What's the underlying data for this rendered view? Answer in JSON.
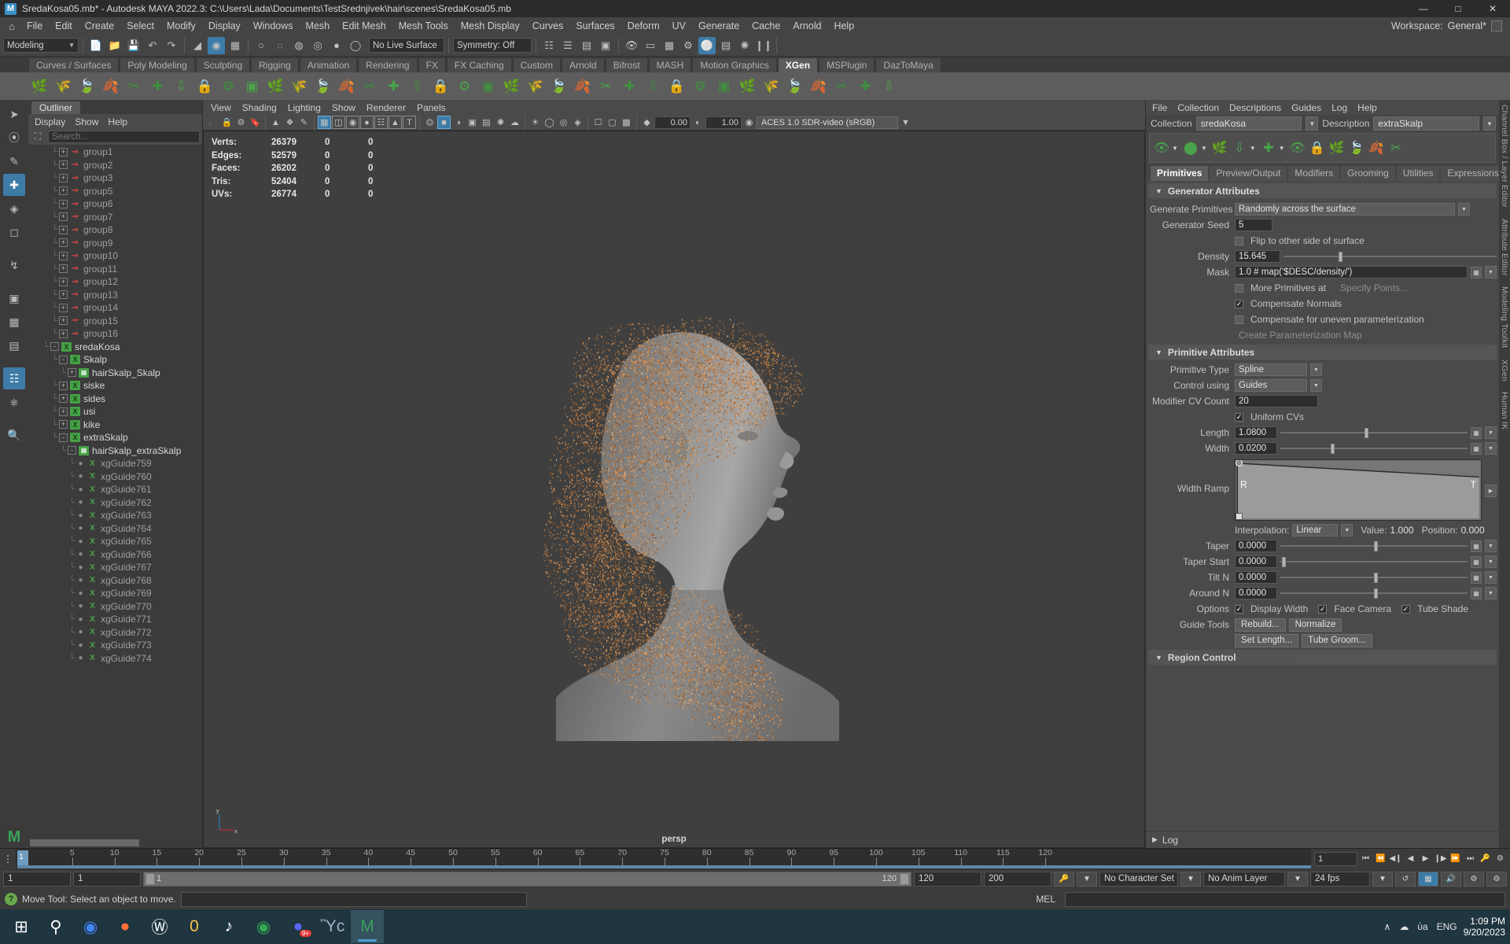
{
  "titlebar": {
    "title": "SredaKosa05.mb* - Autodesk MAYA 2022.3: C:\\Users\\Lada\\Documents\\TestSrednjivek\\hair\\scenes\\SredaKosa05.mb",
    "logo": "M",
    "minimize": "—",
    "maximize": "□",
    "close": "✕"
  },
  "menubar": {
    "home_icon": "home-icon",
    "items": [
      "File",
      "Edit",
      "Create",
      "Select",
      "Modify",
      "Display",
      "Windows",
      "Mesh",
      "Edit Mesh",
      "Mesh Tools",
      "Mesh Display",
      "Curves",
      "Surfaces",
      "Deform",
      "UV",
      "Generate",
      "Cache",
      "Arnold",
      "Help"
    ],
    "workspace_label": "Workspace:",
    "workspace_value": "General*"
  },
  "toolrow": {
    "mode_value": "Modeling",
    "live_surface": "No Live Surface",
    "symmetry": "Symmetry: Off"
  },
  "shelf": {
    "tabs": [
      "Curves / Surfaces",
      "Poly Modeling",
      "Sculpting",
      "Rigging",
      "Animation",
      "Rendering",
      "FX",
      "FX Caching",
      "Custom",
      "Arnold",
      "Bifrost",
      "MASH",
      "Motion Graphics",
      "XGen",
      "MSPlugin",
      "DazToMaya"
    ],
    "active_tab": "XGen"
  },
  "outliner": {
    "tab_label": "Outliner",
    "menus": [
      "Display",
      "Show",
      "Help"
    ],
    "search_placeholder": "Search...",
    "search_value": "",
    "tree": [
      {
        "label": "group1",
        "indent": 2,
        "icon": "group-icon",
        "expander": "+",
        "bright": false
      },
      {
        "label": "group2",
        "indent": 2,
        "icon": "group-icon",
        "expander": "+",
        "bright": false
      },
      {
        "label": "group3",
        "indent": 2,
        "icon": "group-icon",
        "expander": "+",
        "bright": false
      },
      {
        "label": "group5",
        "indent": 2,
        "icon": "group-icon",
        "expander": "+",
        "bright": false
      },
      {
        "label": "group6",
        "indent": 2,
        "icon": "group-icon",
        "expander": "+",
        "bright": false
      },
      {
        "label": "group7",
        "indent": 2,
        "icon": "group-icon",
        "expander": "+",
        "bright": false
      },
      {
        "label": "group8",
        "indent": 2,
        "icon": "group-icon",
        "expander": "+",
        "bright": false
      },
      {
        "label": "group9",
        "indent": 2,
        "icon": "group-icon",
        "expander": "+",
        "bright": false
      },
      {
        "label": "group10",
        "indent": 2,
        "icon": "group-icon",
        "expander": "+",
        "bright": false
      },
      {
        "label": "group11",
        "indent": 2,
        "icon": "group-icon",
        "expander": "+",
        "bright": false
      },
      {
        "label": "group12",
        "indent": 2,
        "icon": "group-icon",
        "expander": "+",
        "bright": false
      },
      {
        "label": "group13",
        "indent": 2,
        "icon": "group-icon",
        "expander": "+",
        "bright": false
      },
      {
        "label": "group14",
        "indent": 2,
        "icon": "group-icon",
        "expander": "+",
        "bright": false
      },
      {
        "label": "group15",
        "indent": 2,
        "icon": "group-icon",
        "expander": "+",
        "bright": false
      },
      {
        "label": "group16",
        "indent": 2,
        "icon": "group-icon",
        "expander": "+",
        "bright": false
      },
      {
        "label": "sredaKosa",
        "indent": 1,
        "icon": "xgen-icon",
        "expander": "-",
        "bright": true
      },
      {
        "label": "Skalp",
        "indent": 2,
        "icon": "xgen-desc-icon",
        "expander": "-",
        "bright": true
      },
      {
        "label": "hairSkalp_Skalp",
        "indent": 3,
        "icon": "mesh-icon",
        "expander": "+",
        "bright": true
      },
      {
        "label": "siske",
        "indent": 2,
        "icon": "xgen-desc-icon",
        "expander": "+",
        "bright": true
      },
      {
        "label": "sides",
        "indent": 2,
        "icon": "xgen-desc-icon",
        "expander": "+",
        "bright": true
      },
      {
        "label": "usi",
        "indent": 2,
        "icon": "xgen-desc-icon",
        "expander": "+",
        "bright": true
      },
      {
        "label": "kike",
        "indent": 2,
        "icon": "xgen-desc-icon",
        "expander": "+",
        "bright": true
      },
      {
        "label": "extraSkalp",
        "indent": 2,
        "icon": "xgen-desc-icon",
        "expander": "-",
        "bright": true
      },
      {
        "label": "hairSkalp_extraSkalp",
        "indent": 3,
        "icon": "mesh-icon",
        "expander": "-",
        "bright": true
      },
      {
        "label": "xgGuide759",
        "indent": 4,
        "icon": "guide-icon",
        "expander": ".",
        "bright": false
      },
      {
        "label": "xgGuide760",
        "indent": 4,
        "icon": "guide-icon",
        "expander": ".",
        "bright": false
      },
      {
        "label": "xgGuide761",
        "indent": 4,
        "icon": "guide-icon",
        "expander": ".",
        "bright": false
      },
      {
        "label": "xgGuide762",
        "indent": 4,
        "icon": "guide-icon",
        "expander": ".",
        "bright": false
      },
      {
        "label": "xgGuide763",
        "indent": 4,
        "icon": "guide-icon",
        "expander": ".",
        "bright": false
      },
      {
        "label": "xgGuide764",
        "indent": 4,
        "icon": "guide-icon",
        "expander": ".",
        "bright": false
      },
      {
        "label": "xgGuide765",
        "indent": 4,
        "icon": "guide-icon",
        "expander": ".",
        "bright": false
      },
      {
        "label": "xgGuide766",
        "indent": 4,
        "icon": "guide-icon",
        "expander": ".",
        "bright": false
      },
      {
        "label": "xgGuide767",
        "indent": 4,
        "icon": "guide-icon",
        "expander": ".",
        "bright": false
      },
      {
        "label": "xgGuide768",
        "indent": 4,
        "icon": "guide-icon",
        "expander": ".",
        "bright": false
      },
      {
        "label": "xgGuide769",
        "indent": 4,
        "icon": "guide-icon",
        "expander": ".",
        "bright": false
      },
      {
        "label": "xgGuide770",
        "indent": 4,
        "icon": "guide-icon",
        "expander": ".",
        "bright": false
      },
      {
        "label": "xgGuide771",
        "indent": 4,
        "icon": "guide-icon",
        "expander": ".",
        "bright": false
      },
      {
        "label": "xgGuide772",
        "indent": 4,
        "icon": "guide-icon",
        "expander": ".",
        "bright": false
      },
      {
        "label": "xgGuide773",
        "indent": 4,
        "icon": "guide-icon",
        "expander": ".",
        "bright": false
      },
      {
        "label": "xgGuide774",
        "indent": 4,
        "icon": "guide-icon",
        "expander": ".",
        "bright": false
      }
    ]
  },
  "viewport": {
    "menus": [
      "View",
      "Shading",
      "Lighting",
      "Show",
      "Renderer",
      "Panels"
    ],
    "exposure": "0.00",
    "gamma": "1.00",
    "color_space": "ACES 1.0 SDR-video (sRGB)",
    "camera_label": "persp",
    "heads_up": {
      "rows": [
        {
          "label": "Verts:",
          "total": "26379",
          "sel": "0",
          "extra": "0"
        },
        {
          "label": "Edges:",
          "total": "52579",
          "sel": "0",
          "extra": "0"
        },
        {
          "label": "Faces:",
          "total": "26202",
          "sel": "0",
          "extra": "0"
        },
        {
          "label": "Tris:",
          "total": "52404",
          "sel": "0",
          "extra": "0"
        },
        {
          "label": "UVs:",
          "total": "26774",
          "sel": "0",
          "extra": "0"
        }
      ]
    }
  },
  "xgen": {
    "menus": [
      "File",
      "Collection",
      "Descriptions",
      "Guides",
      "Log",
      "Help"
    ],
    "collection_label": "Collection",
    "collection_value": "sredaKosa",
    "description_label": "Description",
    "description_value": "extraSkalp",
    "tabs": [
      "Primitives",
      "Preview/Output",
      "Modifiers",
      "Grooming",
      "Utilities",
      "Expressions"
    ],
    "active_tab": "Primitives",
    "generator": {
      "section_title": "Generator Attributes",
      "generate_primitives_label": "Generate Primitives",
      "generate_primitives_value": "Randomly across the surface",
      "generator_seed_label": "Generator Seed",
      "generator_seed_value": "5",
      "flip_label": "Flip to other side of surface",
      "flip_checked": false,
      "density_label": "Density",
      "density_value": "15.645",
      "mask_label": "Mask",
      "mask_value": "1.0 # map('$DESC/density/')",
      "more_primitives_label": "More Primitives at",
      "more_primitives_checked": false,
      "specify_points_label": "Specify Points...",
      "compensate_normals_label": "Compensate Normals",
      "compensate_normals_checked": true,
      "compensate_uneven_label": "Compensate for uneven parameterization",
      "compensate_uneven_checked": false,
      "create_param_map_label": "Create Parameterization Map"
    },
    "primitive": {
      "section_title": "Primitive Attributes",
      "primitive_type_label": "Primitive Type",
      "primitive_type_value": "Spline",
      "control_using_label": "Control using",
      "control_using_value": "Guides",
      "modifier_cv_label": "Modifier CV Count",
      "modifier_cv_value": "20",
      "uniform_cvs_label": "Uniform CVs",
      "uniform_cvs_checked": true,
      "length_label": "Length",
      "length_value": "1.0800",
      "length_slider_pct": 45,
      "width_label": "Width",
      "width_value": "0.0200",
      "width_slider_pct": 27,
      "width_ramp_label": "Width Ramp",
      "interpolation_label": "Interpolation:",
      "interpolation_value": "Linear",
      "ramp_value_label": "Value:",
      "ramp_value": "1.000",
      "ramp_position_label": "Position:",
      "ramp_position": "0.000",
      "ramp_left_letter": "R",
      "ramp_right_letter": "T",
      "taper_label": "Taper",
      "taper_value": "0.0000",
      "taper_slider_pct": 50,
      "taper_start_label": "Taper Start",
      "taper_start_value": "0.0000",
      "taper_start_slider_pct": 2,
      "tilt_label": "Tilt N",
      "tilt_value": "0.0000",
      "tilt_slider_pct": 50,
      "around_label": "Around N",
      "around_value": "0.0000",
      "around_slider_pct": 50,
      "options_label": "Options",
      "display_width_label": "Display Width",
      "display_width_checked": true,
      "face_camera_label": "Face Camera",
      "face_camera_checked": true,
      "tube_shade_label": "Tube Shade",
      "tube_shade_checked": true,
      "guide_tools_label": "Guide Tools",
      "rebuild_label": "Rebuild...",
      "normalize_label": "Normalize",
      "set_length_label": "Set Length...",
      "tube_groom_label": "Tube Groom...",
      "region_control_label": "Region Control"
    },
    "log_label": "Log"
  },
  "right_rail": {
    "labels": [
      "Channel Box / Layer Editor",
      "Attribute Editor",
      "Modeling Toolkit",
      "XGen",
      "Human IK"
    ]
  },
  "timeslider": {
    "ticks": [
      "5",
      "10",
      "15",
      "20",
      "25",
      "30",
      "35",
      "40",
      "45",
      "50",
      "55",
      "60",
      "65",
      "70",
      "75",
      "80",
      "85",
      "90",
      "95",
      "100",
      "105",
      "110",
      "115",
      "120"
    ],
    "current_frame": "1",
    "frame_field": "1",
    "buttons": [
      "⏮",
      "⏪",
      "◀❙",
      "◀",
      "▶",
      "❙▶",
      "⏩",
      "⏭"
    ]
  },
  "rangebar": {
    "start": "1",
    "start2": "1",
    "range_lo": "1",
    "range_hi": "120",
    "end": "120",
    "end2": "200",
    "character_set": "No Character Set",
    "anim_layer": "No Anim Layer",
    "fps": "24 fps"
  },
  "statusbar": {
    "help_icon": "help-icon",
    "message": "Move Tool: Select an object to move.",
    "mel_label": "MEL",
    "command_value": ""
  },
  "taskbar": {
    "icons": [
      {
        "name": "windows-start-icon",
        "glyph": "⊞",
        "color": "#ffffff",
        "active": false
      },
      {
        "name": "search-icon",
        "glyph": "⚲",
        "color": "#ffffff",
        "active": false
      },
      {
        "name": "chrome-icon",
        "glyph": "◉",
        "color": "#4285f4",
        "active": false
      },
      {
        "name": "firefox-icon",
        "glyph": "●",
        "color": "#ff7139",
        "active": false
      },
      {
        "name": "wacom-icon",
        "glyph": "Ⓦ",
        "color": "#ffffff",
        "active": false
      },
      {
        "name": "file-explorer-icon",
        "glyph": "὜0",
        "color": "#f5c34a",
        "active": false
      },
      {
        "name": "tiktok-icon",
        "glyph": "♪",
        "color": "#ffffff",
        "active": false
      },
      {
        "name": "chrome-profile-icon",
        "glyph": "◉",
        "color": "#34a853",
        "active": false
      },
      {
        "name": "discord-icon",
        "glyph": "●",
        "color": "#5865f2",
        "badge": "9+",
        "active": false
      },
      {
        "name": "photos-icon",
        "glyph": "Ὓc",
        "color": "#9fb3c8",
        "active": false
      },
      {
        "name": "maya-icon",
        "glyph": "M",
        "color": "#3aa35a",
        "active": true
      }
    ],
    "tray": [
      "∧",
      "☁",
      "ὐa",
      "ENG"
    ],
    "clock_time": "1:09 PM",
    "clock_date": "9/20/2023"
  },
  "colors": {
    "accent_blue": "#3e7ca8",
    "green": "#4aa34a",
    "panel_bg": "#444444",
    "dark_bg": "#2e2e2e",
    "hair": "#c0722f"
  }
}
